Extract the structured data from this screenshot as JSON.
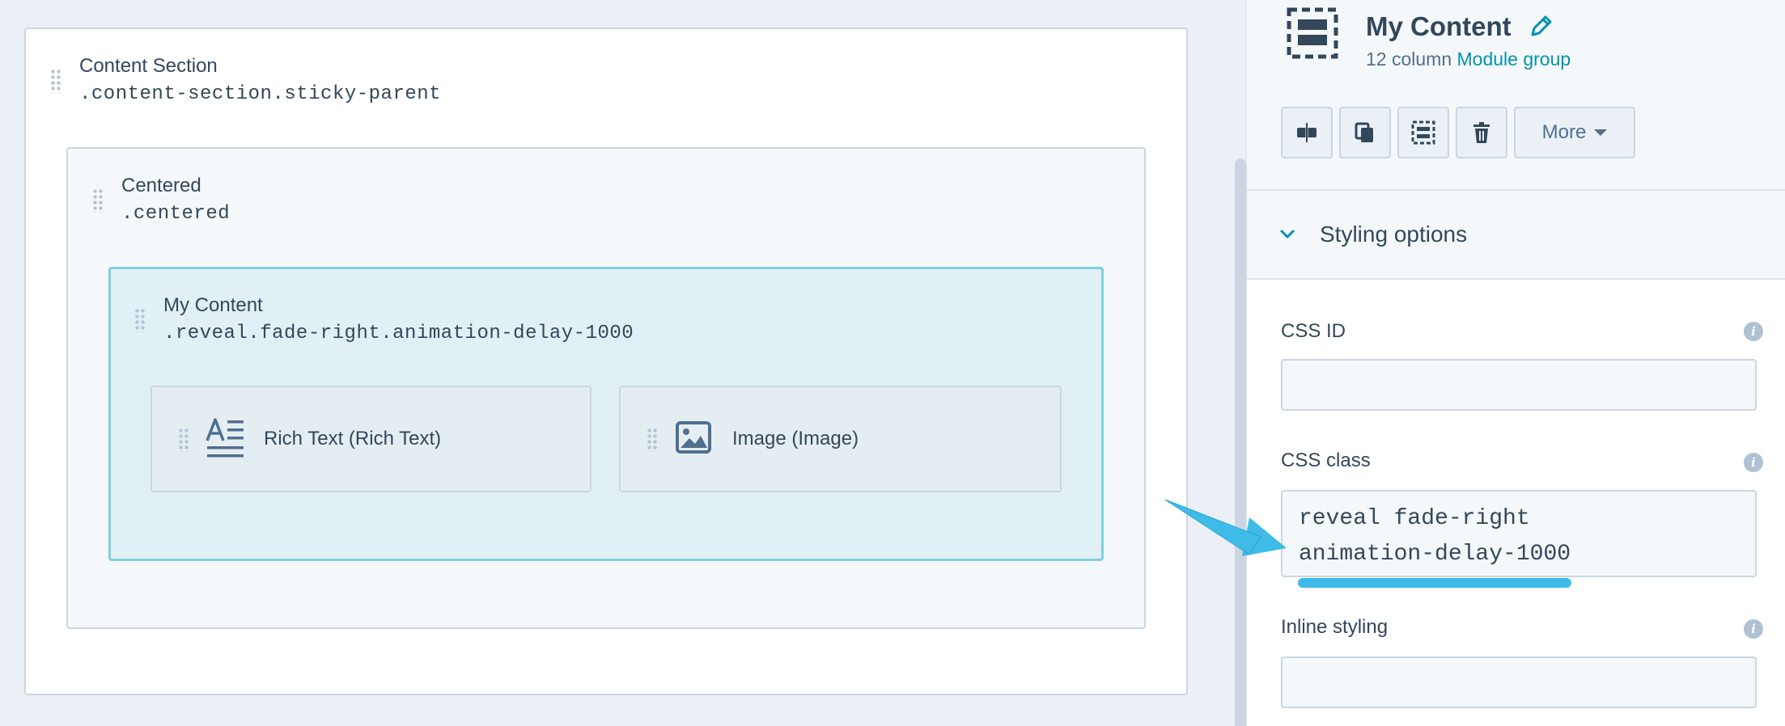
{
  "canvas": {
    "outer_section": {
      "label": "Content Section",
      "class_name": ".content-section.sticky-parent"
    },
    "centered_section": {
      "label": "Centered",
      "class_name": ".centered"
    },
    "content_group": {
      "label": "My Content",
      "class_name": ".reveal.fade-right.animation-delay-1000"
    },
    "modules": [
      {
        "label": "Rich Text (Rich Text)",
        "icon": "rich-text-icon"
      },
      {
        "label": "Image (Image)",
        "icon": "image-icon"
      }
    ]
  },
  "panel": {
    "title": "My Content",
    "subtitle_prefix": "12 column",
    "subtitle_link": "Module group",
    "toolbar": {
      "icons": [
        "split-icon",
        "duplicate-icon",
        "module-group-icon",
        "delete-icon"
      ],
      "more_label": "More"
    },
    "section_title": "Styling options",
    "fields": {
      "css_id": {
        "label": "CSS ID",
        "value": ""
      },
      "css_class": {
        "label": "CSS class",
        "value": "reveal fade-right\nanimation-delay-1000"
      },
      "inline_styling": {
        "label": "Inline styling",
        "value": ""
      }
    }
  },
  "colors": {
    "accent": "#0091ae",
    "selected_border": "#7fd1de",
    "annotation": "#3fbbe8"
  }
}
